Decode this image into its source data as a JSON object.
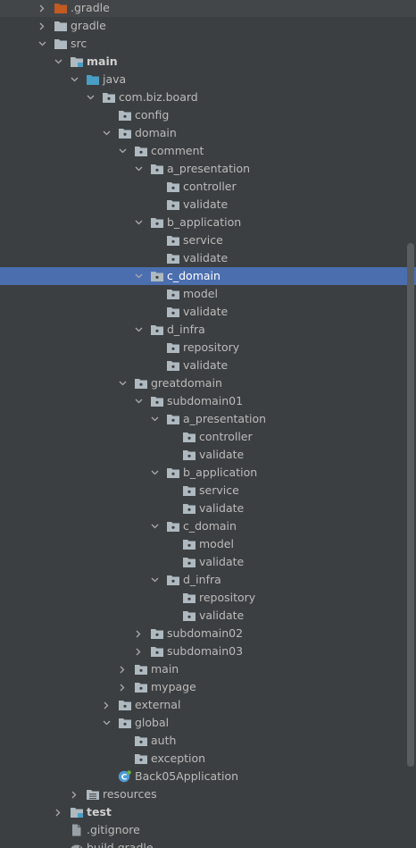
{
  "colors": {
    "background": "#3c3f41",
    "selection": "#4b6eaf",
    "text": "#bbbbbb",
    "folder": "#aeb9c0",
    "package_dot": "#3c3f41",
    "source_folder": "#4a9ec4",
    "gradle_folder": "#c25a22",
    "app_class": "#4b9cd9"
  },
  "tree": [
    {
      "label": ".gradle",
      "depth": 1,
      "arrow": "collapsed",
      "icon": "excluded-folder-icon",
      "highlight": true
    },
    {
      "label": "gradle",
      "depth": 1,
      "arrow": "collapsed",
      "icon": "folder-icon"
    },
    {
      "label": "src",
      "depth": 1,
      "arrow": "expanded",
      "icon": "folder-icon"
    },
    {
      "label": "main",
      "depth": 2,
      "arrow": "expanded",
      "icon": "module-folder-icon",
      "bold": true
    },
    {
      "label": "java",
      "depth": 3,
      "arrow": "expanded",
      "icon": "source-folder-icon"
    },
    {
      "label": "com.biz.board",
      "depth": 4,
      "arrow": "expanded",
      "icon": "package-icon"
    },
    {
      "label": "config",
      "depth": 5,
      "arrow": "none",
      "icon": "package-icon"
    },
    {
      "label": "domain",
      "depth": 5,
      "arrow": "expanded",
      "icon": "package-icon"
    },
    {
      "label": "comment",
      "depth": 6,
      "arrow": "expanded",
      "icon": "package-icon"
    },
    {
      "label": "a_presentation",
      "depth": 7,
      "arrow": "expanded",
      "icon": "package-icon"
    },
    {
      "label": "controller",
      "depth": 8,
      "arrow": "none",
      "icon": "package-icon"
    },
    {
      "label": "validate",
      "depth": 8,
      "arrow": "none",
      "icon": "package-icon"
    },
    {
      "label": "b_application",
      "depth": 7,
      "arrow": "expanded",
      "icon": "package-icon"
    },
    {
      "label": "service",
      "depth": 8,
      "arrow": "none",
      "icon": "package-icon"
    },
    {
      "label": "validate",
      "depth": 8,
      "arrow": "none",
      "icon": "package-icon"
    },
    {
      "label": "c_domain",
      "depth": 7,
      "arrow": "expanded",
      "icon": "package-icon",
      "selected": true
    },
    {
      "label": "model",
      "depth": 8,
      "arrow": "none",
      "icon": "package-icon"
    },
    {
      "label": "validate",
      "depth": 8,
      "arrow": "none",
      "icon": "package-icon"
    },
    {
      "label": "d_infra",
      "depth": 7,
      "arrow": "expanded",
      "icon": "package-icon"
    },
    {
      "label": "repository",
      "depth": 8,
      "arrow": "none",
      "icon": "package-icon"
    },
    {
      "label": "validate",
      "depth": 8,
      "arrow": "none",
      "icon": "package-icon"
    },
    {
      "label": "greatdomain",
      "depth": 6,
      "arrow": "expanded",
      "icon": "package-icon"
    },
    {
      "label": "subdomain01",
      "depth": 7,
      "arrow": "expanded",
      "icon": "package-icon"
    },
    {
      "label": "a_presentation",
      "depth": 8,
      "arrow": "expanded",
      "icon": "package-icon"
    },
    {
      "label": "controller",
      "depth": 9,
      "arrow": "none",
      "icon": "package-icon"
    },
    {
      "label": "validate",
      "depth": 9,
      "arrow": "none",
      "icon": "package-icon"
    },
    {
      "label": "b_application",
      "depth": 8,
      "arrow": "expanded",
      "icon": "package-icon"
    },
    {
      "label": "service",
      "depth": 9,
      "arrow": "none",
      "icon": "package-icon"
    },
    {
      "label": "validate",
      "depth": 9,
      "arrow": "none",
      "icon": "package-icon"
    },
    {
      "label": "c_domain",
      "depth": 8,
      "arrow": "expanded",
      "icon": "package-icon"
    },
    {
      "label": "model",
      "depth": 9,
      "arrow": "none",
      "icon": "package-icon"
    },
    {
      "label": "validate",
      "depth": 9,
      "arrow": "none",
      "icon": "package-icon"
    },
    {
      "label": "d_infra",
      "depth": 8,
      "arrow": "expanded",
      "icon": "package-icon"
    },
    {
      "label": "repository",
      "depth": 9,
      "arrow": "none",
      "icon": "package-icon"
    },
    {
      "label": "validate",
      "depth": 9,
      "arrow": "none",
      "icon": "package-icon"
    },
    {
      "label": "subdomain02",
      "depth": 7,
      "arrow": "collapsed",
      "icon": "package-icon"
    },
    {
      "label": "subdomain03",
      "depth": 7,
      "arrow": "collapsed",
      "icon": "package-icon"
    },
    {
      "label": "main",
      "depth": 6,
      "arrow": "collapsed",
      "icon": "package-icon"
    },
    {
      "label": "mypage",
      "depth": 6,
      "arrow": "collapsed",
      "icon": "package-icon"
    },
    {
      "label": "external",
      "depth": 5,
      "arrow": "collapsed",
      "icon": "package-icon"
    },
    {
      "label": "global",
      "depth": 5,
      "arrow": "expanded",
      "icon": "package-icon"
    },
    {
      "label": "auth",
      "depth": 6,
      "arrow": "none",
      "icon": "package-icon"
    },
    {
      "label": "exception",
      "depth": 6,
      "arrow": "none",
      "icon": "package-icon"
    },
    {
      "label": "Back05Application",
      "depth": 5,
      "arrow": "none",
      "icon": "spring-class-icon"
    },
    {
      "label": "resources",
      "depth": 3,
      "arrow": "collapsed",
      "icon": "resources-folder-icon"
    },
    {
      "label": "test",
      "depth": 2,
      "arrow": "collapsed",
      "icon": "module-folder-icon",
      "bold": true
    },
    {
      "label": ".gitignore",
      "depth": 2,
      "arrow": "none",
      "icon": "file-icon"
    },
    {
      "label": "build.gradle",
      "depth": 2,
      "arrow": "none",
      "icon": "gradle-file-icon"
    }
  ]
}
